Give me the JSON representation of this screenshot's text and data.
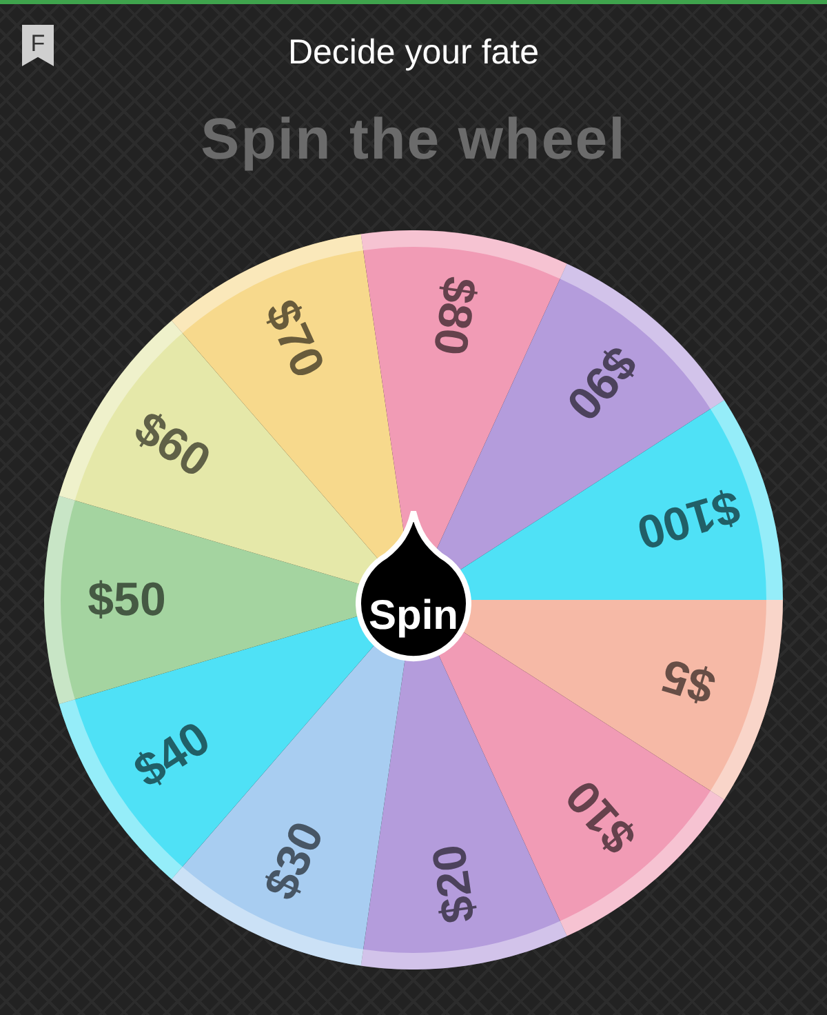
{
  "header": {
    "badge": "F",
    "title": "Decide your fate"
  },
  "heading": "Spin the wheel",
  "wheel": {
    "segments": [
      {
        "label": "$5",
        "color": "#f6b9a6"
      },
      {
        "label": "$10",
        "color": "#f19bb5"
      },
      {
        "label": "$20",
        "color": "#b49cdc"
      },
      {
        "label": "$30",
        "color": "#a8cdf1"
      },
      {
        "label": "$40",
        "color": "#4fe1f6"
      },
      {
        "label": "$50",
        "color": "#a4d4a0"
      },
      {
        "label": "$60",
        "color": "#e5e8a9"
      },
      {
        "label": "$70",
        "color": "#f7d98c"
      },
      {
        "label": "$80",
        "color": "#f19bb5"
      },
      {
        "label": "$90",
        "color": "#b49cdc"
      },
      {
        "label": "$100",
        "color": "#4fe1f6"
      }
    ]
  },
  "spin_button": {
    "label": "Spin"
  }
}
